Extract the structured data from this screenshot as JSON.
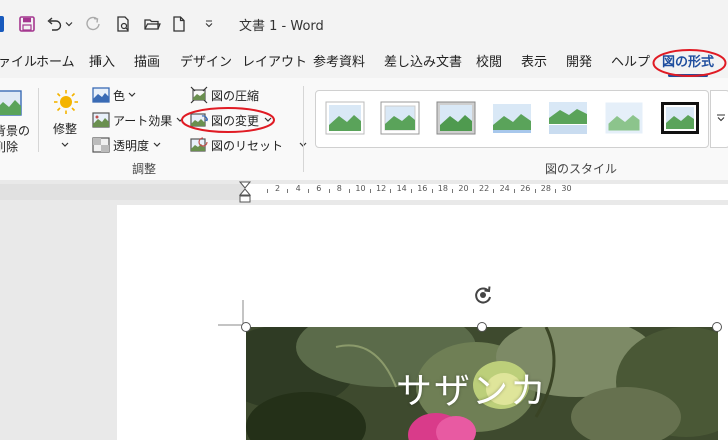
{
  "window": {
    "document_name": "文書 1",
    "app_name": "Word",
    "title": "文書 1  -  Word"
  },
  "quick_access": {
    "icons": [
      "word-logo-icon",
      "save-icon",
      "undo-icon",
      "undo-dropdown-icon",
      "redo-icon",
      "print-preview-icon",
      "open-folder-icon",
      "new-document-icon",
      "customize-dropdown-icon"
    ]
  },
  "tabs": [
    {
      "label": "ァイル"
    },
    {
      "label": "ホーム"
    },
    {
      "label": "挿入"
    },
    {
      "label": "描画"
    },
    {
      "label": "デザイン"
    },
    {
      "label": "レイアウト"
    },
    {
      "label": "参考資料"
    },
    {
      "label": "差し込み文書"
    },
    {
      "label": "校閲"
    },
    {
      "label": "表示"
    },
    {
      "label": "開発"
    },
    {
      "label": "ヘルプ"
    },
    {
      "label": "図の形式",
      "active": true
    }
  ],
  "ribbon": {
    "remove_background": {
      "line1": "背景の",
      "line2": "削除"
    },
    "corrections": {
      "label": "修整"
    },
    "color": {
      "label": "色"
    },
    "artistic_effects": {
      "label": "アート効果"
    },
    "transparency": {
      "label": "透明度"
    },
    "compress": {
      "label": "図の圧縮"
    },
    "change_picture": {
      "label": "図の変更"
    },
    "reset_picture": {
      "label": "図のリセット"
    },
    "adjust_group": {
      "label": "調整"
    },
    "picture_styles_group": {
      "label": "図のスタイル"
    },
    "styles_count": 7
  },
  "ruler": {
    "numbers": [
      "2",
      "4",
      "6",
      "8",
      "10",
      "12",
      "14",
      "16",
      "18",
      "20",
      "22",
      "24",
      "26",
      "28",
      "30"
    ]
  },
  "document": {
    "caption": "サザンカ"
  },
  "annotations": {
    "color": "#e01b24"
  },
  "colors": {
    "accent": "#1f4e9e",
    "save_icon": "#a4378f"
  }
}
